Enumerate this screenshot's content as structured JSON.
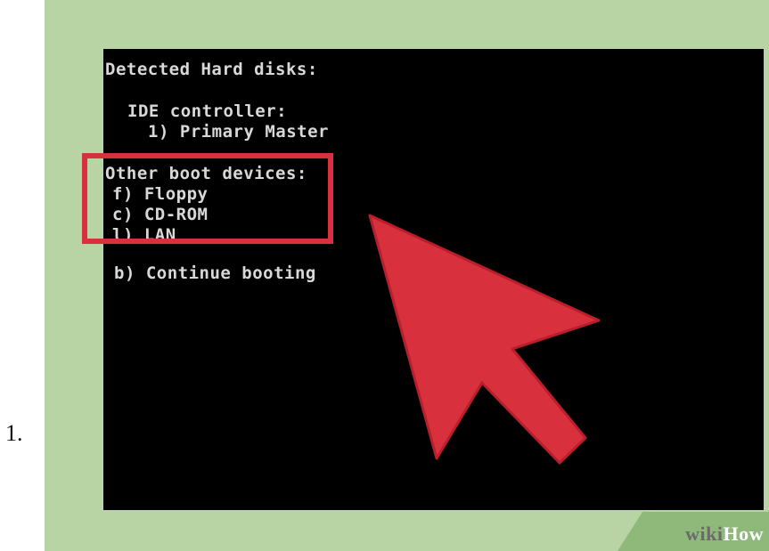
{
  "step": {
    "number": "1."
  },
  "bios": {
    "heading": "Detected Hard disks:",
    "controller_label": "IDE controller:",
    "primary_master": "1) Primary Master",
    "other_devices_label": "Other boot devices:",
    "options": [
      "f) Floppy",
      "c) CD-ROM",
      "l) LAN"
    ],
    "continue_option": "b) Continue booting"
  },
  "colors": {
    "background": "#b8d4a4",
    "screen": "#000000",
    "text": "#d8d8d8",
    "highlight": "#d9303e",
    "arrow": "#d9303e"
  },
  "icons": {
    "pointer": "cursor-arrow-icon"
  },
  "watermark": {
    "part1": "wiki",
    "part2": "How"
  }
}
